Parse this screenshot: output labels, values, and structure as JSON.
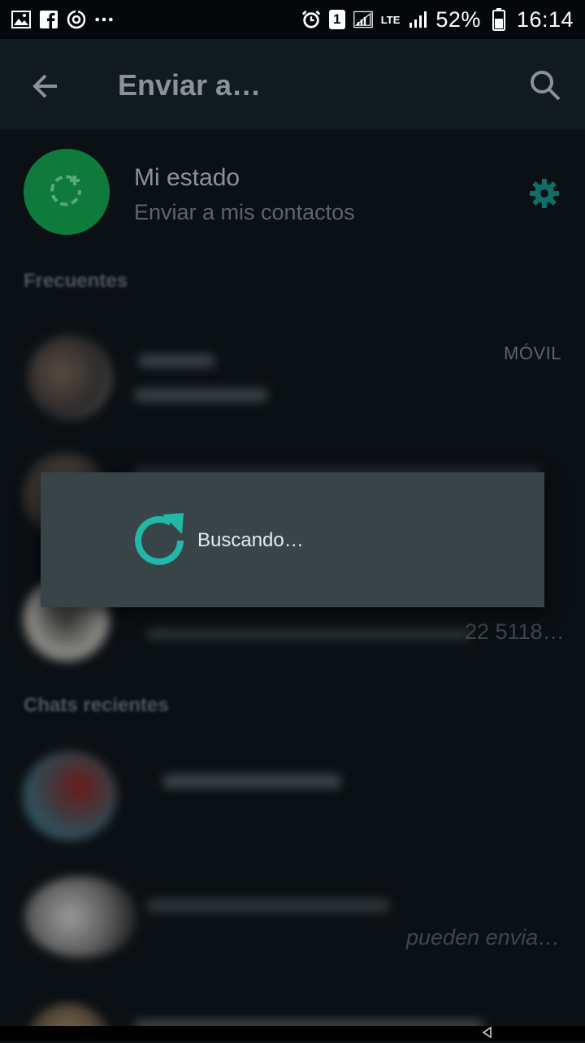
{
  "status_bar": {
    "left_icons": [
      "image-icon",
      "facebook-icon",
      "sync-icon",
      "more-dots-icon"
    ],
    "sim_badge": "1",
    "network": "LTE",
    "battery_percent": "52%",
    "time": "16:14"
  },
  "appbar": {
    "title": "Enviar a…",
    "back_icon": "arrow-back-icon",
    "search_icon": "search-icon"
  },
  "my_status": {
    "name": "Mi estado",
    "subtitle": "Enviar a mis contactos",
    "settings_icon": "gear-icon"
  },
  "sections": {
    "frequent": "Frecuentes",
    "recent": "Chats recientes"
  },
  "frequent_contacts": [
    {
      "badge": "MÓVIL"
    },
    {},
    {
      "trailing": "22 5118…"
    }
  ],
  "recent_chats": [
    {},
    {
      "trailing": "pueden envia…"
    },
    {}
  ],
  "dialog": {
    "text": "Buscando…",
    "icon": "refresh-icon"
  },
  "colors": {
    "accent": "#22b8a8",
    "status_green": "#0e7a3b",
    "dialog_bg": "#394449"
  }
}
